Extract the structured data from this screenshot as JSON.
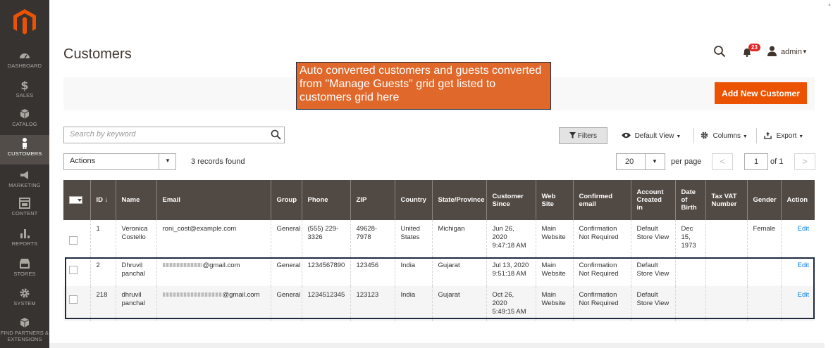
{
  "nav": [
    {
      "label": "DASHBOARD",
      "icon": "dashboard-icon"
    },
    {
      "label": "SALES",
      "icon": "dollar-icon"
    },
    {
      "label": "CATALOG",
      "icon": "cube-icon"
    },
    {
      "label": "CUSTOMERS",
      "icon": "person-icon",
      "active": true
    },
    {
      "label": "MARKETING",
      "icon": "megaphone-icon"
    },
    {
      "label": "CONTENT",
      "icon": "layout-icon"
    },
    {
      "label": "REPORTS",
      "icon": "bar-chart-icon"
    },
    {
      "label": "STORES",
      "icon": "store-icon"
    },
    {
      "label": "SYSTEM",
      "icon": "gear-icon"
    },
    {
      "label": "FIND PARTNERS & EXTENSIONS",
      "icon": "cube-icon"
    }
  ],
  "header": {
    "title": "Customers",
    "notification_count": "23",
    "user": "admin"
  },
  "action_bar": {
    "add_label": "Add New Customer"
  },
  "annotation": {
    "text": "Auto converted customers and guests converted from \"Manage Guests\" grid get listed to customers grid here"
  },
  "toolbar": {
    "search_placeholder": "Search by keyword",
    "filters_label": "Filters",
    "default_view_label": "Default View",
    "columns_label": "Columns",
    "export_label": "Export",
    "actions_label": "Actions",
    "records_found": "3 records found",
    "per_page_value": "20",
    "per_page_label": "per page",
    "page_value": "1",
    "page_of": "of 1"
  },
  "table": {
    "headers": [
      "",
      "ID ↓",
      "Name",
      "Email",
      "Group",
      "Phone",
      "ZIP",
      "Country",
      "State/Province",
      "Customer Since",
      "Web Site",
      "Confirmed email",
      "Account Created in",
      "Date of Birth",
      "Tax VAT Number",
      "Gender",
      "Action"
    ],
    "rows": [
      {
        "id": "1",
        "name": "Veronica Costello",
        "email_prefix": "",
        "email": "roni_cost@example.com",
        "group": "General",
        "phone": "(555) 229-3326",
        "zip": "49628-7978",
        "country": "United States",
        "state": "Michigan",
        "since": "Jun 26, 2020 9:47:18 AM",
        "website": "Main Website",
        "confirmed": "Confirmation Not Required",
        "created_in": "Default Store View",
        "dob": "Dec 15, 1973",
        "taxvat": "",
        "gender": "Female",
        "action": "Edit"
      },
      {
        "id": "2",
        "name": "Dhruvil panchal",
        "email": "@gmail.com",
        "group": "General",
        "phone": "1234567890",
        "zip": "123456",
        "country": "India",
        "state": "Gujarat",
        "since": "Jul 13, 2020 9:51:18 AM",
        "website": "Main Website",
        "confirmed": "Confirmation Not Required",
        "created_in": "Default Store View",
        "dob": "",
        "taxvat": "",
        "gender": "",
        "action": "Edit"
      },
      {
        "id": "218",
        "name": "dhruvil panchal",
        "email": "@gmail.com",
        "group": "General",
        "phone": "1234512345",
        "zip": "123123",
        "country": "India",
        "state": "Gujarat",
        "since": "Oct 26, 2020 5:49:15 AM",
        "website": "Main Website",
        "confirmed": "Confirmation Not Required",
        "created_in": "Default Store View",
        "dob": "",
        "taxvat": "",
        "gender": "",
        "action": "Edit"
      }
    ]
  }
}
